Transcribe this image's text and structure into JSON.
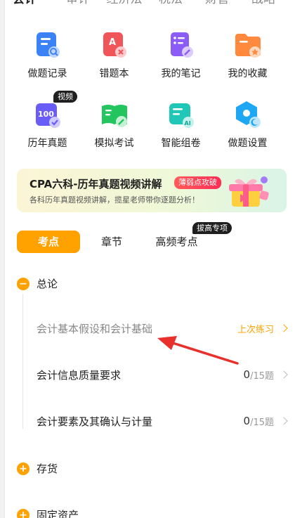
{
  "subject_tabs": [
    "会计",
    "审计",
    "经济法",
    "税法",
    "财管",
    "战略"
  ],
  "tools": [
    {
      "label": "做题记录",
      "icon": "exercise-record-icon"
    },
    {
      "label": "错题本",
      "icon": "wrong-questions-icon"
    },
    {
      "label": "我的笔记",
      "icon": "notes-icon"
    },
    {
      "label": "我的收藏",
      "icon": "favorites-folder-icon"
    },
    {
      "label": "历年真题",
      "icon": "past-papers-icon",
      "badge": "视频"
    },
    {
      "label": "模拟考试",
      "icon": "mock-exam-icon"
    },
    {
      "label": "智能组卷",
      "icon": "ai-paper-icon"
    },
    {
      "label": "做题设置",
      "icon": "settings-hex-icon"
    }
  ],
  "tool_icon_number": "100",
  "tool_icon_ai": "AI",
  "tool_icon_letter": "A",
  "banner": {
    "title": "CPA六科-历年真题视频讲解",
    "badge": "薄弱点攻破",
    "subtitle": "各科历年真题视频讲解，揽星老师带你逐题分析！"
  },
  "segments": {
    "items": [
      "考点",
      "章节",
      "高频考点"
    ],
    "badge": "拔高专项"
  },
  "chapters": [
    {
      "name": "总论",
      "expanded": true
    },
    {
      "name": "存货",
      "expanded": false
    },
    {
      "name": "固定资产",
      "expanded": false
    }
  ],
  "points": [
    {
      "title": "会计基本假设和会计基础",
      "status": "上次练习"
    },
    {
      "title": "会计信息质量要求",
      "done": "0",
      "total": "/15题"
    },
    {
      "title": "会计要素及其确认与计量",
      "done": "0",
      "total": "/15题"
    }
  ],
  "colors": {
    "accent": "#ffa200",
    "annotation_arrow": "#e8302c",
    "badge_bg": "#1f1f1f"
  }
}
